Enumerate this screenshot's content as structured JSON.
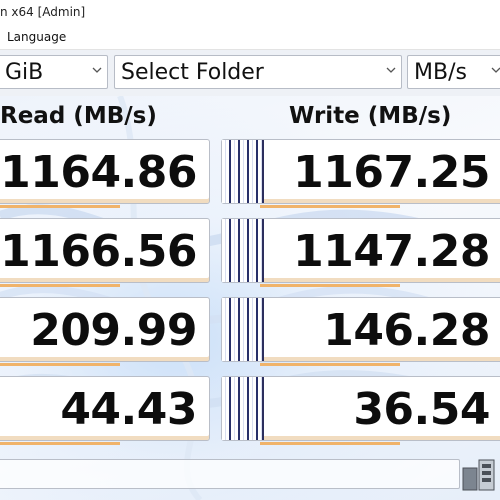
{
  "window": {
    "title": "n x64 [Admin]"
  },
  "menu": {
    "items": [
      "Language"
    ]
  },
  "toolbar": {
    "size_value": "GiB",
    "folder_value": "Select Folder",
    "unit_value": "MB/s"
  },
  "headers": {
    "read": "Read (MB/s)",
    "write": "Write (MB/s)"
  },
  "results": [
    {
      "read": "1164.86",
      "write": "1167.25"
    },
    {
      "read": "1166.56",
      "write": "1147.28"
    },
    {
      "read": "209.99",
      "write": "146.28"
    },
    {
      "read": "44.43",
      "write": "36.54"
    }
  ],
  "icons": {
    "dropdown": "chevron-down-icon",
    "status": "status-icon"
  },
  "colors": {
    "accent_orange": "#f0b36a",
    "bar_navy": "#28306a",
    "background": "#f3f5f9"
  }
}
